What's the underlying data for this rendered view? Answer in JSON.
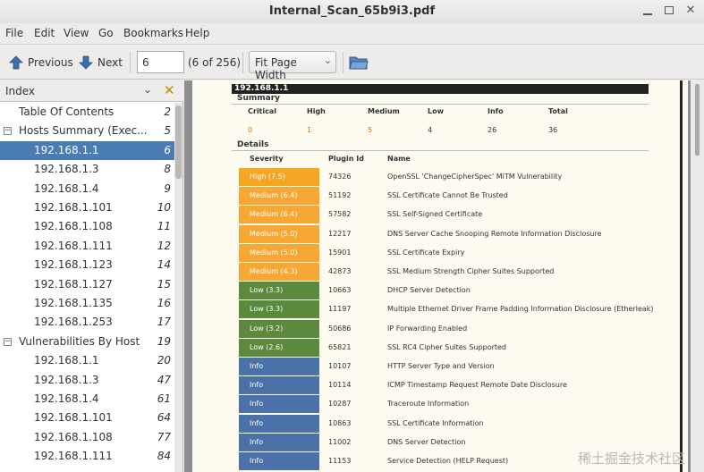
{
  "window": {
    "title": "Internal_Scan_65b9i3.pdf"
  },
  "menu": [
    "File",
    "Edit",
    "View",
    "Go",
    "Bookmarks",
    "Help"
  ],
  "toolbar": {
    "previous_label": "Previous",
    "next_label": "Next",
    "page_value": "6",
    "page_count": "(6 of 256)",
    "zoom": "Fit Page Width"
  },
  "sidebar": {
    "header": "Index",
    "items": [
      {
        "label": "Table Of Contents",
        "page": "2",
        "level": 0
      },
      {
        "label": "Hosts Summary (Exec...",
        "page": "5",
        "level": 0,
        "expander": "−"
      },
      {
        "label": "192.168.1.1",
        "page": "6",
        "level": 1,
        "selected": true
      },
      {
        "label": "192.168.1.3",
        "page": "8",
        "level": 1
      },
      {
        "label": "192.168.1.4",
        "page": "9",
        "level": 1
      },
      {
        "label": "192.168.1.101",
        "page": "10",
        "level": 1
      },
      {
        "label": "192.168.1.108",
        "page": "11",
        "level": 1
      },
      {
        "label": "192.168.1.111",
        "page": "12",
        "level": 1
      },
      {
        "label": "192.168.1.123",
        "page": "14",
        "level": 1
      },
      {
        "label": "192.168.1.127",
        "page": "15",
        "level": 1
      },
      {
        "label": "192.168.1.135",
        "page": "16",
        "level": 1
      },
      {
        "label": "192.168.1.253",
        "page": "17",
        "level": 1
      },
      {
        "label": "Vulnerabilities By Host",
        "page": "19",
        "level": 0,
        "expander": "−"
      },
      {
        "label": "192.168.1.1",
        "page": "20",
        "level": 1
      },
      {
        "label": "192.168.1.3",
        "page": "47",
        "level": 1
      },
      {
        "label": "192.168.1.4",
        "page": "61",
        "level": 1
      },
      {
        "label": "192.168.1.101",
        "page": "64",
        "level": 1
      },
      {
        "label": "192.168.1.108",
        "page": "77",
        "level": 1
      },
      {
        "label": "192.168.1.111",
        "page": "84",
        "level": 1
      }
    ]
  },
  "document": {
    "host": "192.168.1.1",
    "summary_title": "Summary",
    "summary": [
      {
        "label": "Critical",
        "value": "0",
        "color": "#e07000"
      },
      {
        "label": "High",
        "value": "1",
        "color": "#e07000"
      },
      {
        "label": "Medium",
        "value": "5",
        "color": "#e07000"
      },
      {
        "label": "Low",
        "value": "4",
        "color": "#333333"
      },
      {
        "label": "Info",
        "value": "26",
        "color": "#333333"
      },
      {
        "label": "Total",
        "value": "36",
        "color": "#333333"
      }
    ],
    "details_title": "Details",
    "columns": [
      "Severity",
      "Plugin Id",
      "Name"
    ],
    "rows": [
      {
        "severity": "High (7.5)",
        "level": "high",
        "plugin": "74326",
        "name": "OpenSSL 'ChangeCipherSpec' MiTM Vulnerability"
      },
      {
        "severity": "Medium (6.4)",
        "level": "medium",
        "plugin": "51192",
        "name": "SSL Certificate Cannot Be Trusted"
      },
      {
        "severity": "Medium (6.4)",
        "level": "medium",
        "plugin": "57582",
        "name": "SSL Self-Signed Certificate"
      },
      {
        "severity": "Medium (5.0)",
        "level": "medium",
        "plugin": "12217",
        "name": "DNS Server Cache Snooping Remote Information Disclosure"
      },
      {
        "severity": "Medium (5.0)",
        "level": "medium",
        "plugin": "15901",
        "name": "SSL Certificate Expiry"
      },
      {
        "severity": "Medium (4.3)",
        "level": "medium",
        "plugin": "42873",
        "name": "SSL Medium Strength Cipher Suites Supported"
      },
      {
        "severity": "Low (3.3)",
        "level": "low",
        "plugin": "10663",
        "name": "DHCP Server Detection"
      },
      {
        "severity": "Low (3.3)",
        "level": "low",
        "plugin": "11197",
        "name": "Multiple Ethernet Driver Frame Padding Information Disclosure (Etherleak)"
      },
      {
        "severity": "Low (3.2)",
        "level": "low",
        "plugin": "50686",
        "name": "IP Forwarding Enabled"
      },
      {
        "severity": "Low (2.6)",
        "level": "low",
        "plugin": "65821",
        "name": "SSL RC4 Cipher Suites Supported"
      },
      {
        "severity": "Info",
        "level": "info",
        "plugin": "10107",
        "name": "HTTP Server Type and Version"
      },
      {
        "severity": "Info",
        "level": "info",
        "plugin": "10114",
        "name": "ICMP Timestamp Request Remote Date Disclosure"
      },
      {
        "severity": "Info",
        "level": "info",
        "plugin": "10287",
        "name": "Traceroute Information"
      },
      {
        "severity": "Info",
        "level": "info",
        "plugin": "10863",
        "name": "SSL Certificate Information"
      },
      {
        "severity": "Info",
        "level": "info",
        "plugin": "11002",
        "name": "DNS Server Detection"
      },
      {
        "severity": "Info",
        "level": "info",
        "plugin": "11153",
        "name": "Service Detection (HELP Request)"
      }
    ]
  },
  "colors": {
    "high": "#f5a623",
    "medium": "#f7a733",
    "low": "#5b8a3c",
    "info": "#4a72a8",
    "selection": "#4a7cb4"
  },
  "watermark": "稀土掘金技术社区"
}
